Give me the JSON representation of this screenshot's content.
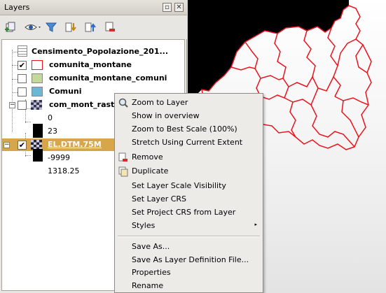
{
  "panel": {
    "title": "Layers",
    "float_glyph": "▫",
    "close_glyph": "✕",
    "toolbar": [
      {
        "name": "add-group-icon"
      },
      {
        "name": "visibility-eye-icon"
      },
      {
        "name": "filter-icon"
      },
      {
        "name": "expand-all-icon"
      },
      {
        "name": "collapse-all-icon"
      },
      {
        "name": "remove-layer-icon"
      }
    ]
  },
  "tree": {
    "expand_minus": "−",
    "check_mark": "✔",
    "items": [
      {
        "label": "Censimento_Popolazione_201...",
        "checked": false
      },
      {
        "label": "comunita_montane",
        "checked": true
      },
      {
        "label": "comunita_montane_comuni",
        "checked": false
      },
      {
        "label": "Comuni",
        "checked": false
      },
      {
        "label": "com_mont_rast",
        "checked": false
      },
      {
        "label": "0"
      },
      {
        "label": "23"
      },
      {
        "label": "EL.DTM.75M",
        "checked": true,
        "selected": true
      },
      {
        "label": "-9999"
      },
      {
        "label": "1318.25"
      }
    ]
  },
  "colors": {
    "selection": "#d8a64a",
    "boundary_red": "#e8141e",
    "comuni_blue": "#6ab8d4",
    "montane_comuni_green": "#c4d89a"
  },
  "menu": {
    "items": [
      {
        "label": "Zoom to Layer",
        "icon": "zoom-icon"
      },
      {
        "label": "Show in overview"
      },
      {
        "label": "Zoom to Best Scale (100%)"
      },
      {
        "label": "Stretch Using Current Extent"
      },
      {
        "label": "Remove",
        "icon": "remove-icon"
      },
      {
        "label": "Duplicate",
        "icon": "duplicate-icon"
      },
      {
        "label": "Set Layer Scale Visibility"
      },
      {
        "label": "Set Layer CRS"
      },
      {
        "label": "Set Project CRS from Layer"
      },
      {
        "label": "Styles",
        "submenu": true
      },
      {
        "label": "Save As..."
      },
      {
        "label": "Save As Layer Definition File..."
      },
      {
        "label": "Properties"
      },
      {
        "label": "Rename"
      }
    ],
    "submenu_arrow": "▸"
  }
}
